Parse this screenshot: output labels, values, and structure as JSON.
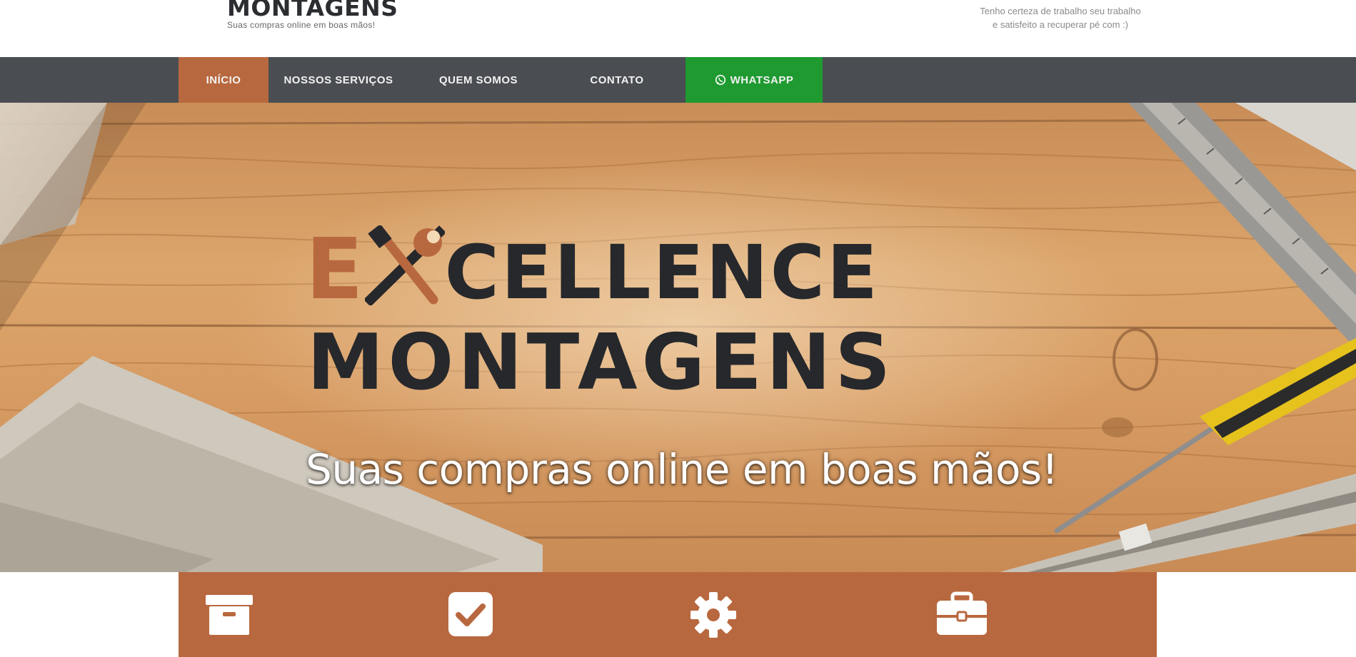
{
  "header": {
    "logo_title": "MONTAGENS",
    "logo_tagline": "Suas compras online em boas mãos!",
    "note_line1": "Tenho certeza de trabalho seu trabalho",
    "note_line2": "e satisfeito a recuperar pé com :)"
  },
  "nav": {
    "items": [
      {
        "label": "INÍCIO",
        "active": true
      },
      {
        "label": "NOSSOS SERVIÇOS"
      },
      {
        "label": "QUEM SOMOS"
      },
      {
        "label": "CONTATO"
      },
      {
        "label": "WHATSAPP",
        "icon": "whatsapp-icon"
      }
    ]
  },
  "hero": {
    "title_letter": "E",
    "title_rest": "CELLENCE",
    "title_line2": "MONTAGENS",
    "tagline": "Suas compras online em boas mãos!"
  },
  "features": {
    "icons": [
      "archive-box-icon",
      "checkbox-icon",
      "gear-icon",
      "toolbox-icon"
    ]
  },
  "colors": {
    "accent": "#b8683f",
    "nav_bg": "#4a4d52",
    "whatsapp": "#1f9a30",
    "text_dark": "#26282b"
  }
}
